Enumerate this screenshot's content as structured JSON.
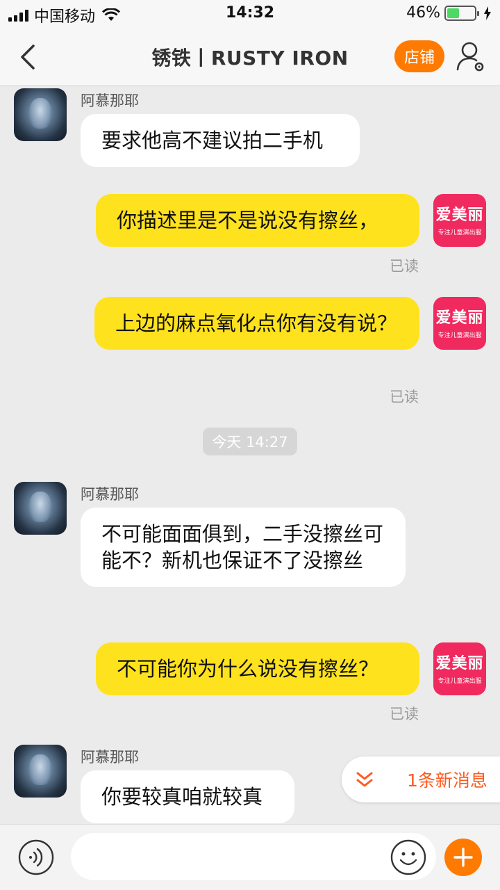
{
  "status_bar": {
    "carrier": "中国移动",
    "time": "14:32",
    "battery_percent_label": "46%",
    "battery_level": 0.46
  },
  "header": {
    "title": "锈铁丨RUSTY IRON",
    "shop_label": "店铺"
  },
  "peer": {
    "name": "阿慕那耶"
  },
  "self_avatar": {
    "brand": "爱美丽",
    "tagline": "专注儿童演出服"
  },
  "messages": [
    {
      "side": "in",
      "sender": "阿慕那耶",
      "text": "要求他高不建议拍二手机"
    },
    {
      "side": "out",
      "text": "你描述里是不是说没有擦丝，",
      "status": "已读"
    },
    {
      "side": "out",
      "text": "上边的麻点氧化点你有没有说？",
      "status": "已读"
    },
    {
      "side": "time",
      "text": "今天 14:27"
    },
    {
      "side": "in",
      "sender": "阿慕那耶",
      "text": "不可能面面俱到，二手没擦丝可能不？新机也保证不了没擦丝"
    },
    {
      "side": "out",
      "text": "不可能你为什么说没有擦丝？",
      "status": "已读"
    },
    {
      "side": "in",
      "sender": "阿慕那耶",
      "text": "你要较真咱就较真"
    }
  ],
  "new_message_notice": "1条新消息",
  "input": {
    "placeholder": ""
  },
  "colors": {
    "accent": "#ff7a00",
    "outgoing_bubble": "#ffe21e",
    "incoming_bubble": "#ffffff",
    "background": "#ebebeb"
  }
}
